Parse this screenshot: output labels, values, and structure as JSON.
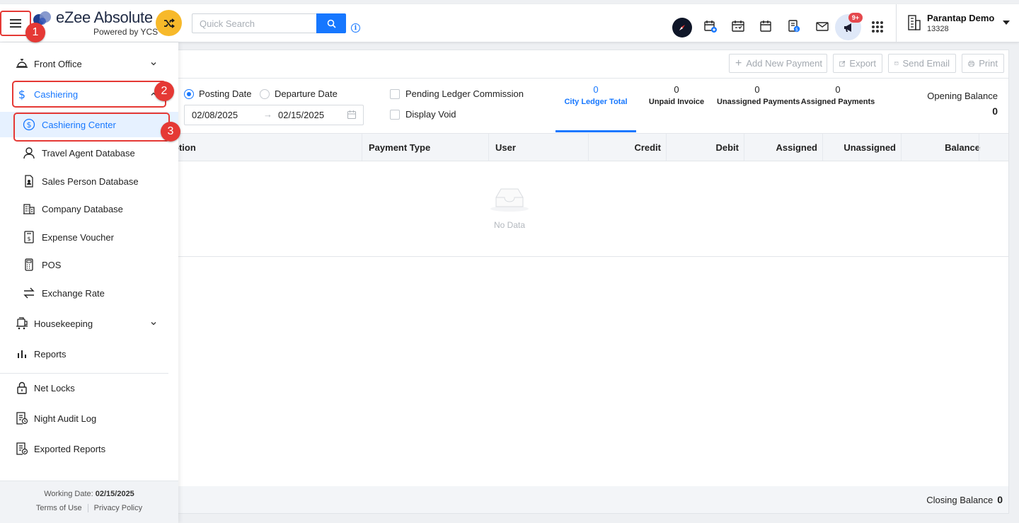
{
  "header": {
    "brand_name": "eZee Absolute",
    "brand_tagline": "Powered by YCS",
    "search_placeholder": "Quick Search",
    "notification_badge": "9+",
    "property_name": "Parantap Demo",
    "property_id": "13328"
  },
  "sidebar": {
    "front_office": "Front Office",
    "cashiering": "Cashiering",
    "cashiering_items": [
      {
        "label": "Cashiering Center",
        "icon": "dollar-circle-icon"
      },
      {
        "label": "Travel Agent Database",
        "icon": "person-icon"
      },
      {
        "label": "Sales Person Database",
        "icon": "badge-icon"
      },
      {
        "label": "Company Database",
        "icon": "building-icon"
      },
      {
        "label": "Expense Voucher",
        "icon": "voucher-icon"
      },
      {
        "label": "POS",
        "icon": "pos-terminal-icon"
      },
      {
        "label": "Exchange Rate",
        "icon": "exchange-icon"
      }
    ],
    "housekeeping": "Housekeeping",
    "reports": "Reports",
    "net_locks": "Net Locks",
    "night_audit_log": "Night Audit Log",
    "exported_reports": "Exported Reports",
    "working_date_label": "Working Date:",
    "working_date_value": "02/15/2025",
    "terms": "Terms of Use",
    "privacy": "Privacy Policy"
  },
  "steps": [
    "1",
    "2",
    "3"
  ],
  "actions": {
    "add_payment": "Add New Payment",
    "export": "Export",
    "send_email": "Send Email",
    "print": "Print"
  },
  "filters": {
    "posting_date": "Posting Date",
    "departure_date": "Departure Date",
    "selected_date_type": "Posting Date",
    "date_from": "02/08/2025",
    "date_to": "02/15/2025",
    "pending_ledger": "Pending Ledger Commission",
    "display_void": "Display Void"
  },
  "stats": [
    {
      "value": "0",
      "label": "City Ledger Total"
    },
    {
      "value": "0",
      "label": "Unpaid Invoice"
    },
    {
      "value": "0",
      "label": "Unassigned Payments"
    },
    {
      "value": "0",
      "label": "Assigned Payments"
    }
  ],
  "opening_balance": {
    "label": "Opening Balance",
    "value": "0"
  },
  "table": {
    "columns": [
      "ption",
      "Payment Type",
      "User",
      "Credit",
      "Debit",
      "Assigned",
      "Unassigned",
      "Balance"
    ],
    "empty_text": "No Data"
  },
  "closing_balance": {
    "label": "Closing Balance",
    "value": "0"
  },
  "colors": {
    "accent": "#1677ff",
    "highlight": "#e53935",
    "brand_orange": "#f7b92a"
  }
}
